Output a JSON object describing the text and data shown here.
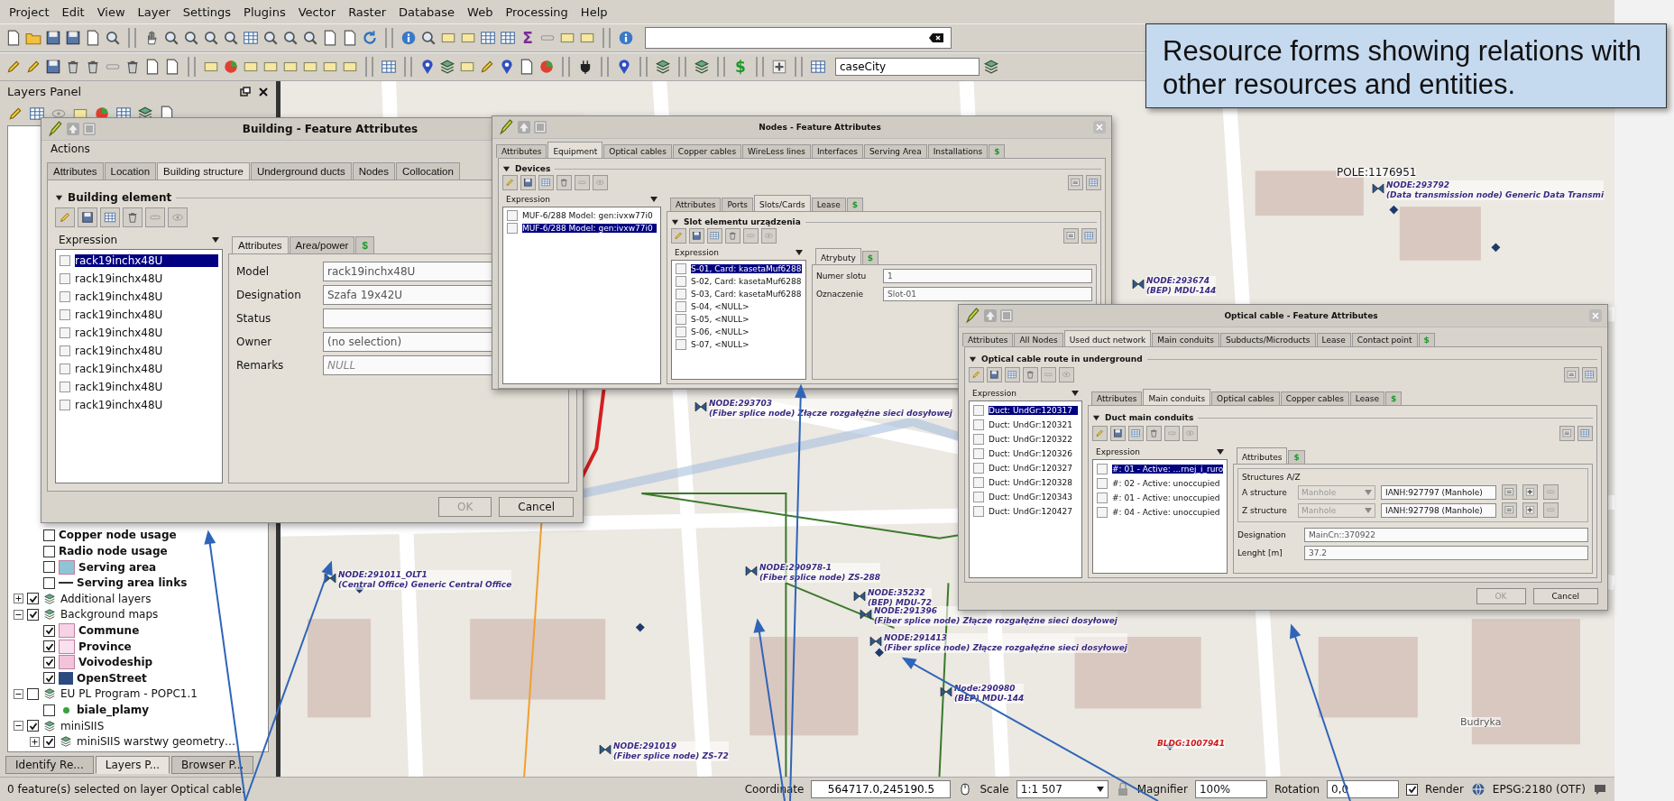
{
  "menu": [
    "Project",
    "Edit",
    "View",
    "Layer",
    "Settings",
    "Plugins",
    "Vector",
    "Raster",
    "Database",
    "Web",
    "Processing",
    "Help"
  ],
  "toolbar": {
    "sum_glyph": "Σ",
    "action_glyph": "$",
    "layer_field": "caseCity"
  },
  "layers_panel": {
    "title": "Layers Panel",
    "tree": [
      {
        "kind": "continuation",
        "children": [
          {
            "label": "Copper node usage",
            "kind": "layer",
            "checked": false
          },
          {
            "label": "Radio node usage",
            "kind": "layer",
            "checked": false
          },
          {
            "label": "Serving area",
            "kind": "fill",
            "checked": false,
            "color": "#8ec5d6"
          },
          {
            "label": "Serving area links",
            "kind": "line",
            "checked": false,
            "color": "#333333"
          }
        ]
      },
      {
        "label": "Additional layers",
        "kind": "group",
        "checked": true,
        "expanded": false
      },
      {
        "label": "Background maps",
        "kind": "group",
        "checked": true,
        "expanded": true,
        "children": [
          {
            "label": "Commune",
            "kind": "fill",
            "checked": true,
            "color": "#f6d2e6"
          },
          {
            "label": "Province",
            "kind": "fill",
            "checked": true,
            "color": "#f8e0ee"
          },
          {
            "label": "Voivodeship",
            "kind": "fill",
            "checked": true,
            "color": "#f2c4dc"
          },
          {
            "label": "OpenStreet",
            "kind": "raster",
            "checked": true,
            "color": "#2a4a80"
          }
        ]
      },
      {
        "label": "EU PL Program - POPC1.1",
        "kind": "group",
        "checked": false,
        "expanded": true,
        "children": [
          {
            "label": "biale_plamy",
            "kind": "dot",
            "checked": false,
            "color": "#3aa040"
          }
        ]
      },
      {
        "label": "miniSIIS",
        "kind": "group",
        "checked": true,
        "expanded": true,
        "children": [
          {
            "label": "miniSIIS warstwy geometry…",
            "kind": "group",
            "checked": true,
            "expanded": false
          }
        ]
      }
    ],
    "tabs": [
      {
        "label": "Identify Re...",
        "selected": false
      },
      {
        "label": "Layers P...",
        "selected": true
      },
      {
        "label": "Browser P...",
        "selected": false
      }
    ]
  },
  "dialogs": [
    {
      "title": "Building - Feature Attributes",
      "menu": "Actions",
      "tabs": [
        {
          "label": "Attributes",
          "selected": false
        },
        {
          "label": "Location",
          "selected": false
        },
        {
          "label": "Building structure",
          "selected": true
        },
        {
          "label": "Underground ducts",
          "selected": false
        },
        {
          "label": "Nodes",
          "selected": false
        },
        {
          "label": "Collocation",
          "selected": false
        }
      ],
      "body": {
        "group": "Building element",
        "header": "Expression",
        "items": [
          {
            "label": "rack19inchx48U",
            "selected": true
          },
          {
            "label": "rack19inchx48U",
            "selected": false
          },
          {
            "label": "rack19inchx48U",
            "selected": false
          },
          {
            "label": "rack19inchx48U",
            "selected": false
          },
          {
            "label": "rack19inchx48U",
            "selected": false
          },
          {
            "label": "rack19inchx48U",
            "selected": false
          },
          {
            "label": "rack19inchx48U",
            "selected": false
          },
          {
            "label": "rack19inchx48U",
            "selected": false
          },
          {
            "label": "rack19inchx48U",
            "selected": false
          }
        ],
        "subtabs": [
          {
            "label": "Attributes",
            "selected": true
          },
          {
            "label": "Area/power",
            "selected": false
          }
        ],
        "action_tab": "$",
        "fields": [
          {
            "label": "Model",
            "value": "rack19inchx48U"
          },
          {
            "label": "Designation",
            "value": "Szafa 19x42U"
          },
          {
            "label": "Status"
          },
          {
            "label": "Owner",
            "value": "(no selection)"
          },
          {
            "label": "Remarks",
            "placeholder": "NULL"
          }
        ]
      },
      "buttons": [
        {
          "label": "OK",
          "disabled": true
        },
        {
          "label": "Cancel",
          "disabled": false
        }
      ]
    },
    {
      "title": "Nodes - Feature Attributes",
      "tabs": [
        {
          "label": "Attributes",
          "selected": false
        },
        {
          "label": "Equipment",
          "selected": true
        },
        {
          "label": "Optical cables",
          "selected": false
        },
        {
          "label": "Copper cables",
          "selected": false
        },
        {
          "label": "WireLess lines",
          "selected": false
        },
        {
          "label": "Interfaces",
          "selected": false
        },
        {
          "label": "Serving Area",
          "selected": false
        },
        {
          "label": "Installations",
          "selected": false
        }
      ],
      "action_tab": "$",
      "body": {
        "group": "Devices",
        "header": "Expression",
        "items": [
          {
            "label": "MUF-6/288 Model: gen:ivxw77i0",
            "selected": false
          },
          {
            "label": "MUF-6/288 Model: gen:ivxw77i0",
            "selected": true
          }
        ],
        "subtabs": [
          {
            "label": "Attributes",
            "selected": false
          },
          {
            "label": "Ports",
            "selected": false
          },
          {
            "label": "Slots/Cards",
            "selected": true
          },
          {
            "label": "Lease",
            "selected": false
          }
        ],
        "action_tab": "$",
        "inner": {
          "group": "Slot elementu urządzenia",
          "header": "Expression",
          "items": [
            {
              "label": "S-01, Card: kasetaMuf6288",
              "selected": true
            },
            {
              "label": "S-02, Card: kasetaMuf6288",
              "selected": false
            },
            {
              "label": "S-03, Card: kasetaMuf6288",
              "selected": false
            },
            {
              "label": "S-04, <NULL>",
              "selected": false
            },
            {
              "label": "S-05, <NULL>",
              "selected": false
            },
            {
              "label": "S-06, <NULL>",
              "selected": false
            },
            {
              "label": "S-07, <NULL>",
              "selected": false
            }
          ],
          "tabs": [
            {
              "label": "Atrybuty",
              "selected": true
            }
          ],
          "action_tab": "$",
          "fields": [
            {
              "label": "Numer slotu",
              "value": "1"
            },
            {
              "label": "Oznaczenie",
              "value": "Slot-01"
            }
          ]
        }
      }
    },
    {
      "title": "Optical cable - Feature Attributes",
      "tabs": [
        {
          "label": "Attributes",
          "selected": false
        },
        {
          "label": "All Nodes",
          "selected": false
        },
        {
          "label": "Used duct network",
          "selected": true
        },
        {
          "label": "Main conduits",
          "selected": false
        },
        {
          "label": "Subducts/Microducts",
          "selected": false
        },
        {
          "label": "Lease",
          "selected": false
        },
        {
          "label": "Contact point",
          "selected": false
        }
      ],
      "action_tab": "$",
      "body": {
        "group": "Optical cable route in underground",
        "header": "Expression",
        "items": [
          {
            "label": "Duct: UndGr:120317",
            "selected": true
          },
          {
            "label": "Duct: UndGr:120321",
            "selected": false
          },
          {
            "label": "Duct: UndGr:120322",
            "selected": false
          },
          {
            "label": "Duct: UndGr:120326",
            "selected": false
          },
          {
            "label": "Duct: UndGr:120327",
            "selected": false
          },
          {
            "label": "Duct: UndGr:120328",
            "selected": false
          },
          {
            "label": "Duct: UndGr:120343",
            "selected": false
          },
          {
            "label": "Duct: UndGr:120427",
            "selected": false
          }
        ],
        "subtabs": [
          {
            "label": "Attributes",
            "selected": false
          },
          {
            "label": "Main conduits",
            "selected": true
          },
          {
            "label": "Optical cables",
            "selected": false
          },
          {
            "label": "Copper cables",
            "selected": false
          },
          {
            "label": "Lease",
            "selected": false
          }
        ],
        "action_tab": "$",
        "inner": {
          "group": "Duct main conduits",
          "header": "Expression",
          "items": [
            {
              "label": "#: 01 - Active: ...rnej_i_ruro",
              "selected": true
            },
            {
              "label": "#: 02 - Active: unoccupied",
              "selected": false
            },
            {
              "label": "#: 01 - Active: unoccupied",
              "selected": false
            },
            {
              "label": "#: 04 - Active: unoccupied",
              "selected": false
            }
          ],
          "tabs": [
            {
              "label": "Attributes",
              "selected": true
            }
          ],
          "action_tab": "$",
          "structures": {
            "group": "Structures A/Z",
            "rows": [
              {
                "label": "A structure",
                "type": "Manhole",
                "value": "IANH:927797 (Manhole)"
              },
              {
                "label": "Z structure",
                "type": "Manhole",
                "value": "IANH:927798 (Manhole)"
              }
            ]
          },
          "fields": [
            {
              "label": "Designation",
              "value": "MainCn::370922"
            },
            {
              "label": "Lenght [m]",
              "value": "37.2"
            }
          ]
        }
      },
      "buttons": [
        {
          "label": "OK",
          "disabled": true
        },
        {
          "label": "Cancel",
          "disabled": false
        }
      ]
    }
  ],
  "map_labels": [
    {
      "kind": "node",
      "id": "NODE:293792",
      "desc": "(Data transmission node) Generic Data Transmi"
    },
    {
      "kind": "pole",
      "id": "POLE:1176951"
    },
    {
      "kind": "node",
      "id": "NODE:293674",
      "desc": "(BEP) MDU-144"
    },
    {
      "kind": "node",
      "id": "NODE:293703",
      "desc": "(Fiber splice node) Złącze rozgałęźne sieci dosyłowej"
    },
    {
      "kind": "node",
      "id": "NODE:291011_OLT1",
      "desc": "(Central Office) Generic Central Office"
    },
    {
      "kind": "node",
      "id": "NODE:290978-1",
      "desc": "(Fiber splice node) ZS-288"
    },
    {
      "kind": "node",
      "id": "NODE:35232",
      "desc": "(BEP) MDU-72"
    },
    {
      "kind": "node",
      "id": "NODE:291396",
      "desc": "(Fiber splice node) Złącze rozgałęźne sieci dosyłowej"
    },
    {
      "kind": "node",
      "id": "NODE:291413",
      "desc": "(Fiber splice node) Złącze rozgałęźne sieci dosyłowej"
    },
    {
      "kind": "node",
      "id": "Node:290980",
      "desc": "(BEP) MDU-144"
    },
    {
      "kind": "node",
      "id": "NODE:291019",
      "desc": "(Fiber splice node) ZS-72"
    },
    {
      "kind": "building",
      "id": "BLDG:1007941"
    },
    {
      "kind": "street",
      "id": "Budryka"
    }
  ],
  "callout": "Resource forms showing relations with other resources and entities.",
  "status_bar": {
    "message": "0 feature(s) selected on layer Optical cable.",
    "coordinate_label": "Coordinate",
    "coordinate": "564717.0,245190.5",
    "scale_label": "Scale",
    "scale": "1:1 507",
    "magnifier_label": "Magnifier",
    "magnifier": "100%",
    "rotation_label": "Rotation",
    "rotation": "0,0",
    "render": {
      "label": "Render",
      "checked": true
    },
    "crs": "EPSG:2180 (OTF)"
  }
}
